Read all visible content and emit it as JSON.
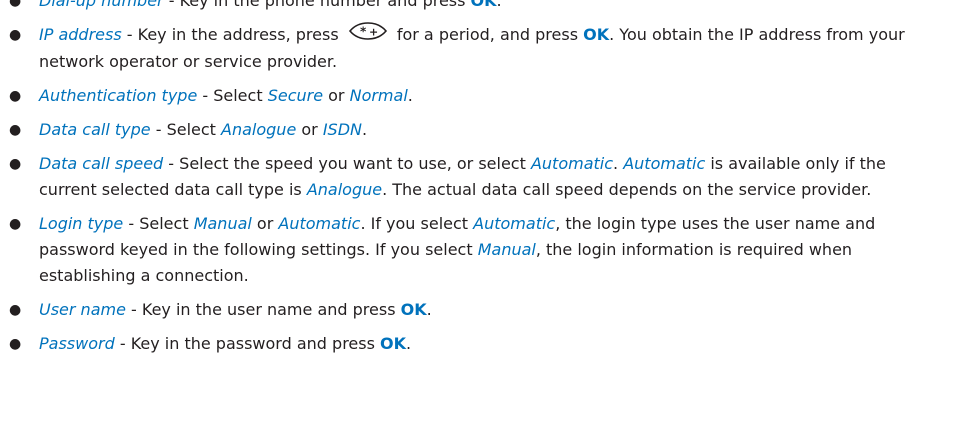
{
  "items": [
    {
      "term": "Dial-up number",
      "sep": " - ",
      "text": "Key in the phone number and press ",
      "key": "OK",
      "end": "."
    },
    {
      "term": "IP address",
      "sep": " - ",
      "text_before": "Key in the address, press ",
      "key_icon": "star-plus-key-icon",
      "text_after": " for a period, and press ",
      "key": "OK",
      "end": ". You obtain the IP address from your network operator or service provider."
    },
    {
      "term": "Authentication type",
      "sep": " - ",
      "text": "Select ",
      "opt1": "Secure",
      "or": " or ",
      "opt2": "Normal",
      "end": "."
    },
    {
      "term": "Data call type",
      "sep": " - ",
      "text": "Select ",
      "opt1": "Analogue",
      "or": " or ",
      "opt2": "ISDN",
      "end": "."
    },
    {
      "term": "Data call speed",
      "sep": " - ",
      "text": "Select the speed you want to use, or select ",
      "opt1": "Automatic",
      "mid1": ". ",
      "opt2": "Automatic",
      "mid2": " is available only if the current selected data call type is ",
      "opt3": "Analogue",
      "end": ". The actual data call speed depends on the service provider."
    },
    {
      "term": "Login type",
      "sep": " - ",
      "text": "Select ",
      "opt1": "Manual",
      "or": " or ",
      "opt2": "Automatic",
      "mid1": ". If you select ",
      "opt3": "Automatic",
      "mid2": ", the login type uses the user name and password keyed in the following settings. If you select ",
      "opt4": "Manual",
      "end": ", the login information is required when establishing a connection."
    },
    {
      "term": "User name",
      "sep": " - ",
      "text": "Key in the user name and press ",
      "key": "OK",
      "end": "."
    },
    {
      "term": "Password",
      "sep": " - ",
      "text": "Key in the password and press ",
      "key": "OK",
      "end": "."
    }
  ],
  "colors": {
    "term": "#0072bc",
    "body_text": "#231f20"
  }
}
